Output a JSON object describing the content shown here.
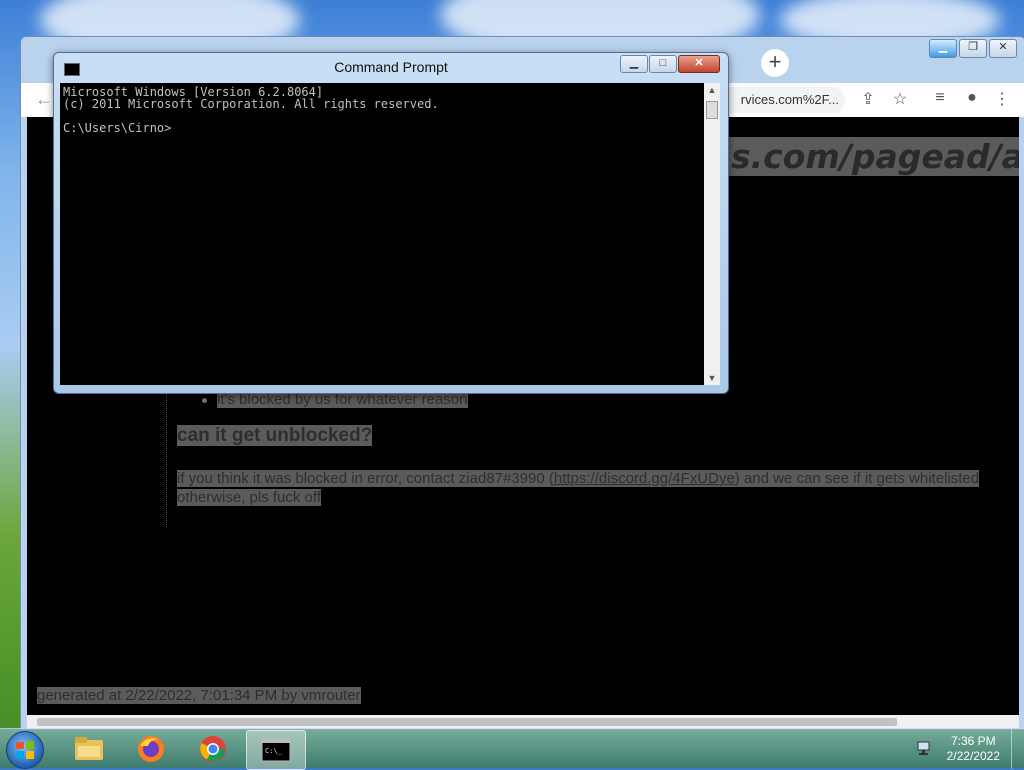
{
  "chrome": {
    "omnibox_text": "rvices.com%2F...",
    "url_heading": "s.com/pagead/a",
    "page": {
      "bullet": "it's blocked by us for whatever reason",
      "heading": "can it get unblocked?",
      "paragraph_prefix": "if you think it was blocked in error, contact ziad87#3990 (",
      "paragraph_link": "https://discord.gg/4FxUDye",
      "paragraph_suffix": ") and we can see if it gets whitelisted",
      "paragraph_line2": "otherwise, pls fuck off",
      "footer": "generated at 2/22/2022, 7:01:34 PM by vmrouter"
    }
  },
  "cmd": {
    "title": "Command Prompt",
    "lines": [
      "Microsoft Windows [Version 6.2.8064]",
      "(c) 2011 Microsoft Corporation. All rights reserved.",
      "",
      "C:\\Users\\Cirno>"
    ]
  },
  "taskbar": {
    "items": [
      {
        "name": "file-explorer-icon"
      },
      {
        "name": "firefox-icon"
      },
      {
        "name": "chrome-icon"
      },
      {
        "name": "command-prompt-icon",
        "active": true
      }
    ],
    "time": "7:36 PM",
    "date": "2/22/2022"
  }
}
